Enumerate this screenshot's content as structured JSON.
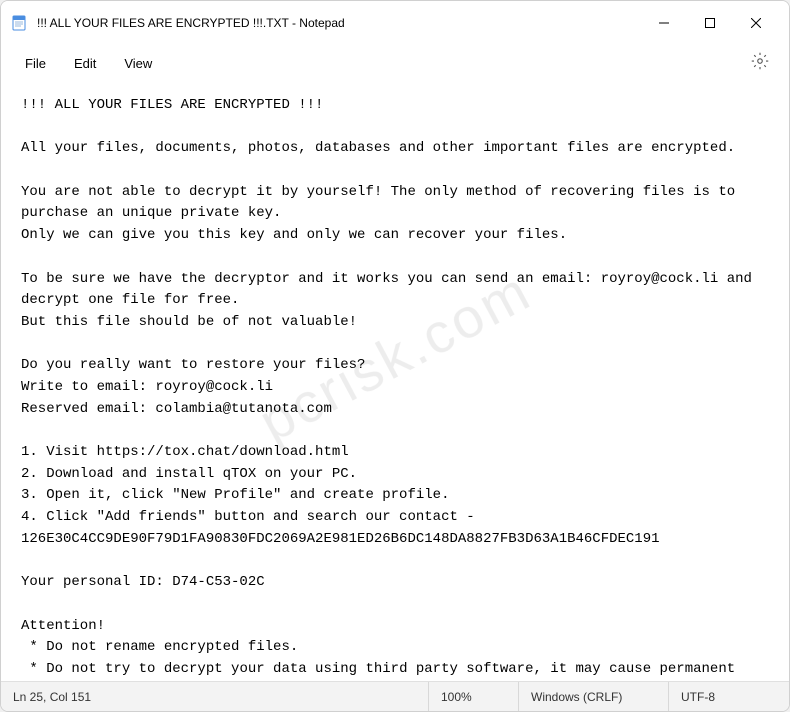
{
  "titlebar": {
    "title": "!!! ALL YOUR FILES ARE ENCRYPTED !!!.TXT - Notepad"
  },
  "menubar": {
    "file": "File",
    "edit": "Edit",
    "view": "View"
  },
  "content": {
    "text": "!!! ALL YOUR FILES ARE ENCRYPTED !!!\n\nAll your files, documents, photos, databases and other important files are encrypted.\n\nYou are not able to decrypt it by yourself! The only method of recovering files is to purchase an unique private key.\nOnly we can give you this key and only we can recover your files.\n\nTo be sure we have the decryptor and it works you can send an email: royroy@cock.li and decrypt one file for free.\nBut this file should be of not valuable!\n\nDo you really want to restore your files?\nWrite to email: royroy@cock.li\nReserved email: colambia@tutanota.com\n\n1. Visit https://tox.chat/download.html\n2. Download and install qTOX on your PC.\n3. Open it, click \"New Profile\" and create profile.\n4. Click \"Add friends\" button and search our contact - 126E30C4CC9DE90F79D1FA90830FDC2069A2E981ED26B6DC148DA8827FB3D63A1B46CFDEC191\n\nYour personal ID: D74-C53-02C\n\nAttention!\n * Do not rename encrypted files.\n * Do not try to decrypt your data using third party software, it may cause permanent data loss.\n * Decryption of your files with the help of third parties may cause increased price (they add their fee to our) or you can become a victim of a scam."
  },
  "statusbar": {
    "position": "Ln 25, Col 151",
    "zoom": "100%",
    "lineending": "Windows (CRLF)",
    "encoding": "UTF-8"
  },
  "watermark": "pcrisk.com"
}
